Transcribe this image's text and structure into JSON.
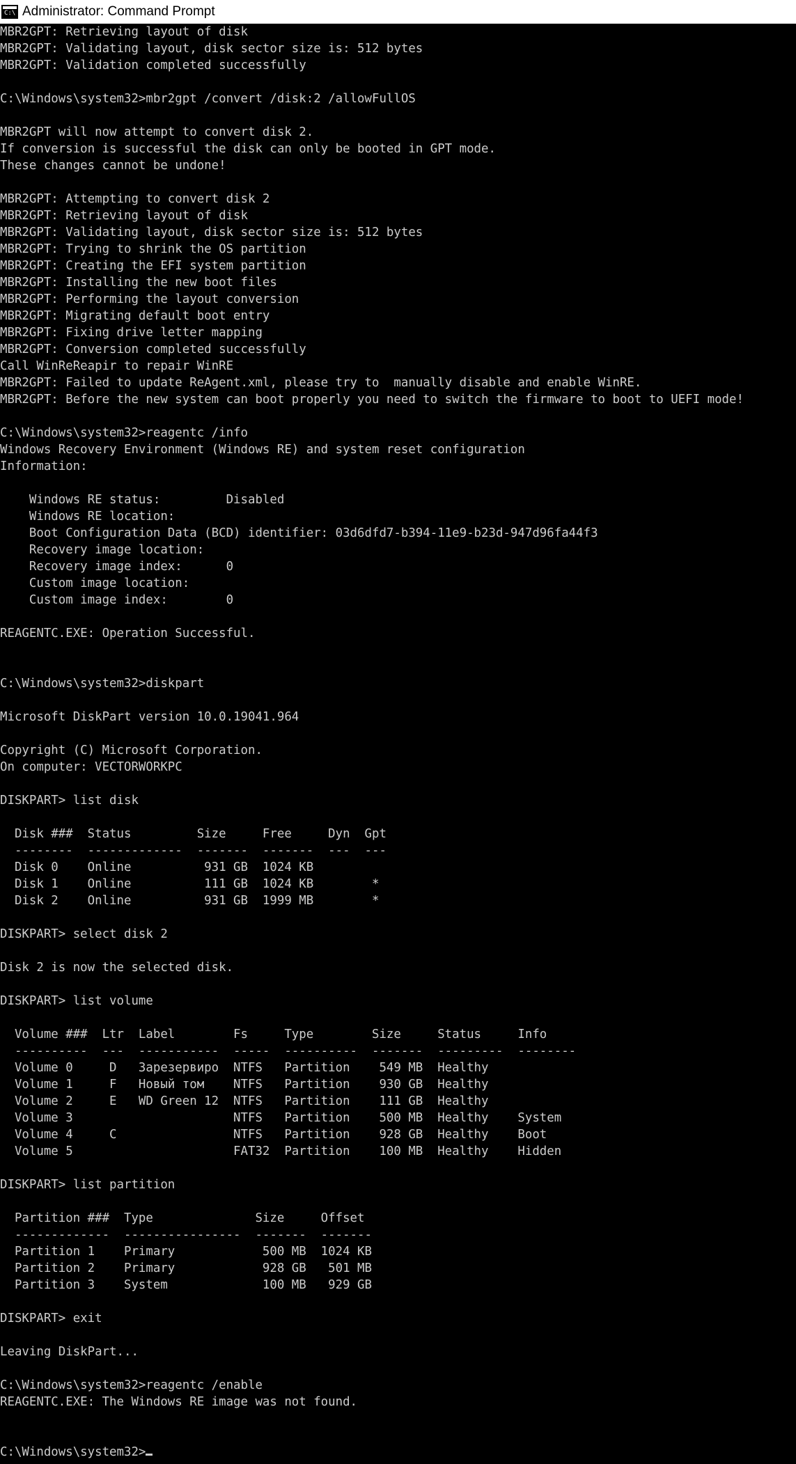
{
  "window": {
    "title": "Administrator: Command Prompt",
    "icon": "cmd-icon",
    "icon_glyph": "C:\\"
  },
  "console": {
    "lines": [
      "MBR2GPT: Retrieving layout of disk",
      "MBR2GPT: Validating layout, disk sector size is: 512 bytes",
      "MBR2GPT: Validation completed successfully",
      "",
      "C:\\Windows\\system32>mbr2gpt /convert /disk:2 /allowFullOS",
      "",
      "MBR2GPT will now attempt to convert disk 2.",
      "If conversion is successful the disk can only be booted in GPT mode.",
      "These changes cannot be undone!",
      "",
      "MBR2GPT: Attempting to convert disk 2",
      "MBR2GPT: Retrieving layout of disk",
      "MBR2GPT: Validating layout, disk sector size is: 512 bytes",
      "MBR2GPT: Trying to shrink the OS partition",
      "MBR2GPT: Creating the EFI system partition",
      "MBR2GPT: Installing the new boot files",
      "MBR2GPT: Performing the layout conversion",
      "MBR2GPT: Migrating default boot entry",
      "MBR2GPT: Fixing drive letter mapping",
      "MBR2GPT: Conversion completed successfully",
      "Call WinReReapir to repair WinRE",
      "MBR2GPT: Failed to update ReAgent.xml, please try to  manually disable and enable WinRE.",
      "MBR2GPT: Before the new system can boot properly you need to switch the firmware to boot to UEFI mode!",
      "",
      "C:\\Windows\\system32>reagentc /info",
      "Windows Recovery Environment (Windows RE) and system reset configuration",
      "Information:",
      "",
      "    Windows RE status:         Disabled",
      "    Windows RE location:",
      "    Boot Configuration Data (BCD) identifier: 03d6dfd7-b394-11e9-b23d-947d96fa44f3",
      "    Recovery image location:",
      "    Recovery image index:      0",
      "    Custom image location:",
      "    Custom image index:        0",
      "",
      "REAGENTC.EXE: Operation Successful.",
      "",
      "",
      "C:\\Windows\\system32>diskpart",
      "",
      "Microsoft DiskPart version 10.0.19041.964",
      "",
      "Copyright (C) Microsoft Corporation.",
      "On computer: VECTORWORKPC",
      "",
      "DISKPART> list disk",
      "",
      "  Disk ###  Status         Size     Free     Dyn  Gpt",
      "  --------  -------------  -------  -------  ---  ---",
      "  Disk 0    Online          931 GB  1024 KB",
      "  Disk 1    Online          111 GB  1024 KB        *",
      "  Disk 2    Online          931 GB  1999 MB        *",
      "",
      "DISKPART> select disk 2",
      "",
      "Disk 2 is now the selected disk.",
      "",
      "DISKPART> list volume",
      "",
      "  Volume ###  Ltr  Label        Fs     Type        Size     Status     Info",
      "  ----------  ---  -----------  -----  ----------  -------  ---------  --------",
      "  Volume 0     D   Зарезервиро  NTFS   Partition    549 MB  Healthy",
      "  Volume 1     F   Новый том    NTFS   Partition    930 GB  Healthy",
      "  Volume 2     E   WD Green 12  NTFS   Partition    111 GB  Healthy",
      "  Volume 3                      NTFS   Partition    500 MB  Healthy    System",
      "  Volume 4     C                NTFS   Partition    928 GB  Healthy    Boot",
      "  Volume 5                      FAT32  Partition    100 MB  Healthy    Hidden",
      "",
      "DISKPART> list partition",
      "",
      "  Partition ###  Type              Size     Offset",
      "  -------------  ----------------  -------  -------",
      "  Partition 1    Primary            500 MB  1024 KB",
      "  Partition 2    Primary            928 GB   501 MB",
      "  Partition 3    System             100 MB   929 GB",
      "",
      "DISKPART> exit",
      "",
      "Leaving DiskPart...",
      "",
      "C:\\Windows\\system32>reagentc /enable",
      "REAGENTC.EXE: The Windows RE image was not found.",
      "",
      "",
      "C:\\Windows\\system32>"
    ]
  },
  "colors": {
    "background": "#000000",
    "foreground": "#cccccc",
    "titlebar": "#ffffff"
  }
}
